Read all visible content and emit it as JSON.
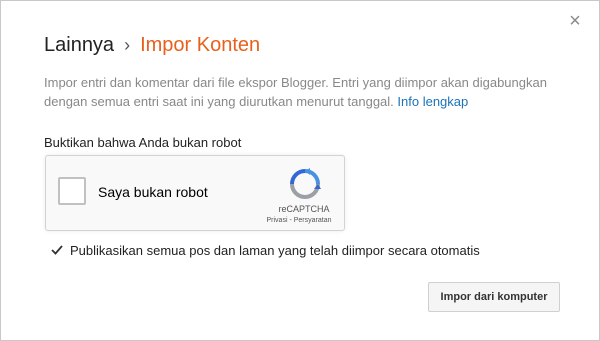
{
  "dialog": {
    "breadcrumb": {
      "parent": "Lainnya",
      "separator": "›",
      "current": "Impor Konten"
    },
    "description": "Impor entri dan komentar dari file ekspor Blogger. Entri yang diimpor akan digabungkan dengan semua entri saat ini yang diurutkan menurut tanggal.",
    "info_link": "Info lengkap",
    "close_icon": "close-icon"
  },
  "captcha": {
    "prompt": "Buktikan bahwa Anda bukan robot",
    "checkbox_label": "Saya bukan robot",
    "brand": "reCAPTCHA",
    "privacy_link": "Privasi",
    "links_separator": " - ",
    "terms_link": "Persyaratan",
    "checked": false
  },
  "auto_publish": {
    "label": "Publikasikan semua pos dan laman yang telah diimpor secara otomatis",
    "checked": true
  },
  "actions": {
    "import_button": "Impor dari komputer"
  },
  "colors": {
    "accent": "#e8601c",
    "link": "#1a73b8",
    "recaptcha_blue": "#4a90e2"
  }
}
